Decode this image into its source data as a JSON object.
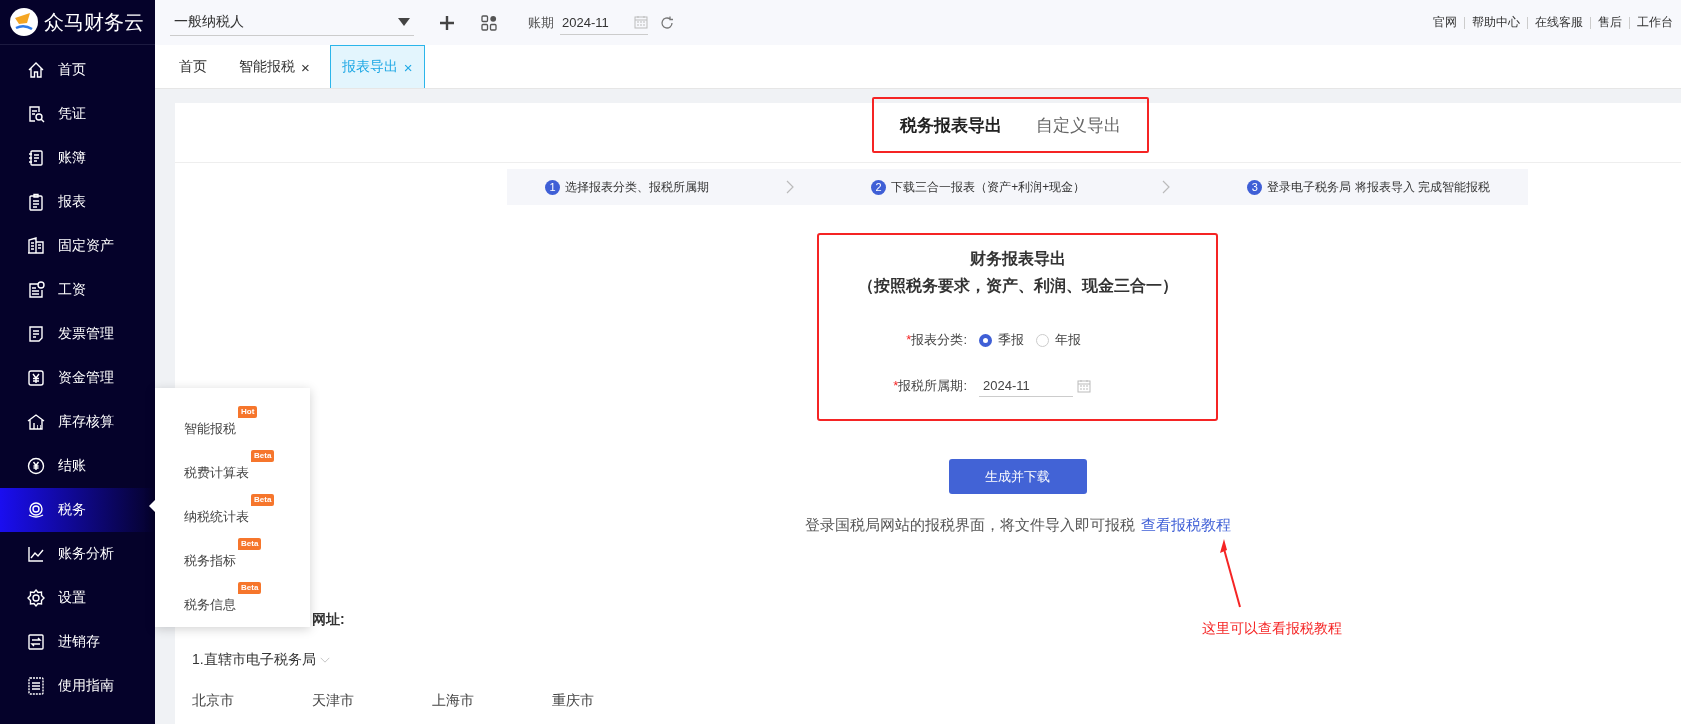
{
  "brand": {
    "name": "众马财务云"
  },
  "topbar": {
    "taxpayer_select": {
      "value": "一般纳税人"
    },
    "period_label": "账期",
    "period_field": {
      "value": "2024-11"
    },
    "links": [
      "官网",
      "帮助中心",
      "在线客服",
      "售后",
      "工作台"
    ]
  },
  "sidebar": {
    "items": [
      {
        "label": "首页",
        "kind": "home",
        "selected": false
      },
      {
        "label": "凭证",
        "kind": "voucher",
        "selected": false
      },
      {
        "label": "账簿",
        "kind": "ledger",
        "selected": false
      },
      {
        "label": "报表",
        "kind": "report",
        "selected": false
      },
      {
        "label": "固定资产",
        "kind": "assets",
        "selected": false
      },
      {
        "label": "工资",
        "kind": "salary",
        "selected": false
      },
      {
        "label": "发票管理",
        "kind": "invoice",
        "selected": false
      },
      {
        "label": "资金管理",
        "kind": "funds",
        "selected": false
      },
      {
        "label": "库存核算",
        "kind": "inventory",
        "selected": false
      },
      {
        "label": "结账",
        "kind": "closing",
        "selected": false
      },
      {
        "label": "税务",
        "kind": "tax",
        "selected": true
      },
      {
        "label": "账务分析",
        "kind": "analysis",
        "selected": false
      },
      {
        "label": "设置",
        "kind": "settings",
        "selected": false
      },
      {
        "label": "进销存",
        "kind": "stock",
        "selected": false
      },
      {
        "label": "使用指南",
        "kind": "guide",
        "selected": false
      }
    ]
  },
  "page_tabs": [
    {
      "label": "首页",
      "closable": false,
      "selected": false
    },
    {
      "label": "智能报税",
      "closable": true,
      "selected": false
    },
    {
      "label": "报表导出",
      "closable": true,
      "selected": true
    }
  ],
  "close_glyph": "×",
  "popup_menu": {
    "items": [
      {
        "label": "智能报税",
        "badge": "Hot"
      },
      {
        "label": "税费计算表",
        "badge": "Beta"
      },
      {
        "label": "纳税统计表",
        "badge": "Beta"
      },
      {
        "label": "税务指标",
        "badge": "Beta"
      },
      {
        "label": "税务信息",
        "badge": "Beta"
      }
    ]
  },
  "export_tabs": {
    "highlighted": true,
    "items": [
      {
        "label": "税务报表导出",
        "selected": true
      },
      {
        "label": "自定义导出",
        "selected": false
      }
    ]
  },
  "steps": [
    {
      "number": "1",
      "text": "选择报表分类、报税所属期"
    },
    {
      "number": "2",
      "text": "下载三合一报表（资产+利润+现金）"
    },
    {
      "number": "3",
      "text": "登录电子税务局 将报表导入 完成智能报税"
    }
  ],
  "form": {
    "highlighted": true,
    "title": "财务报表导出",
    "subtitle": "（按照税务要求，资产、利润、现金三合一）",
    "category": {
      "required_mark": "*",
      "label": "报表分类:",
      "options": [
        {
          "label": "季报",
          "selected": true
        },
        {
          "label": "年报",
          "selected": false
        }
      ]
    },
    "period": {
      "required_mark": "*",
      "label": "报税所属期:",
      "value": "2024-11"
    }
  },
  "generate_button": "生成并下载",
  "hint": {
    "text": "登录国税局网站的报税界面，将文件导入即可报税",
    "link": "查看报税教程"
  },
  "annotation": {
    "text": "这里可以查看报税教程"
  },
  "websites": {
    "heading": "网址:",
    "group": "1.直辖市电子税务局",
    "cities": [
      "北京市",
      "天津市",
      "上海市",
      "重庆市"
    ]
  }
}
